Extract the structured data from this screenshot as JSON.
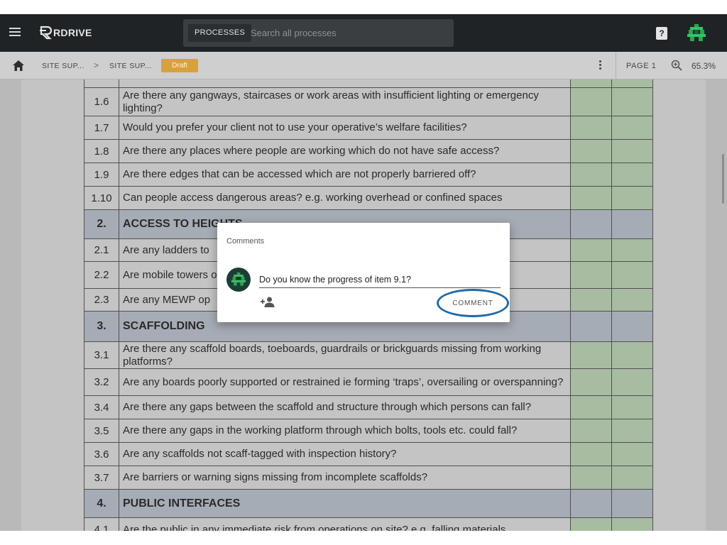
{
  "topbar": {
    "logo_text": "RDRIVE",
    "search_scope": "PROCESSES",
    "search_placeholder": "Search all processes",
    "help_label": "?"
  },
  "breadcrumb": {
    "items": [
      "SITE SUP...",
      "SITE SUP..."
    ],
    "separator": ">",
    "badge": "Draft",
    "page_label": "PAGE 1",
    "zoom": "65.3%"
  },
  "checklist": {
    "rows": [
      {
        "num": "",
        "text": "",
        "section": false
      },
      {
        "num": "1.6",
        "text": "Are there any gangways, staircases or work areas with insufficient lighting or emergency lighting?",
        "section": false
      },
      {
        "num": "1.7",
        "text": "Would you prefer your client not to use your operative’s welfare facilities?",
        "section": false
      },
      {
        "num": "1.8",
        "text": "Are there any places where people are working which do not have safe access?",
        "section": false
      },
      {
        "num": "1.9",
        "text": "Are there edges that can be accessed which are not properly barriered off?",
        "section": false
      },
      {
        "num": "1.10",
        "text": "Can people access dangerous areas? e.g. working overhead or confined spaces",
        "section": false
      },
      {
        "num": "2.",
        "text": "ACCESS TO HEIGHTS",
        "section": true
      },
      {
        "num": "2.1",
        "text": "Are any ladders to",
        "section": false
      },
      {
        "num": "2.2",
        "text": "Are mobile towers outriggers",
        "section": false
      },
      {
        "num": "2.3",
        "text": "Are any MEWP op",
        "section": false
      },
      {
        "num": "3.",
        "text": "SCAFFOLDING",
        "section": true
      },
      {
        "num": "3.1",
        "text": "Are there any scaffold boards, toeboards, guardrails or brickguards missing from working platforms?",
        "section": false
      },
      {
        "num": "3.2",
        "text": "Are any boards poorly supported or restrained ie forming ‘traps’, oversailing or overspanning?",
        "section": false
      },
      {
        "num": "3.4",
        "text": "Are there any gaps between the scaffold and structure through which persons can fall?",
        "section": false
      },
      {
        "num": "3.5",
        "text": "Are there any gaps in the working platform through which bolts, tools etc. could fall?",
        "section": false
      },
      {
        "num": "3.6",
        "text": "Are any scaffolds not scaff-tagged with inspection history?",
        "section": false
      },
      {
        "num": "3.7",
        "text": "Are barriers or warning signs missing from incomplete scaffolds?",
        "section": false
      },
      {
        "num": "4.",
        "text": "PUBLIC INTERFACES",
        "section": true
      },
      {
        "num": "4.1",
        "text": "Are the public in any immediate risk from operations on site? e.g. falling materials",
        "section": false
      }
    ]
  },
  "dialog": {
    "title": "Comments",
    "comment_value": "Do you know the progress of item 9.1?",
    "submit_label": "COMMENT"
  },
  "colors": {
    "topbar": "#1f2326",
    "badge": "#d9a13c",
    "highlight_ring": "#1e6aa8",
    "avatar_green": "#2ea44f"
  }
}
